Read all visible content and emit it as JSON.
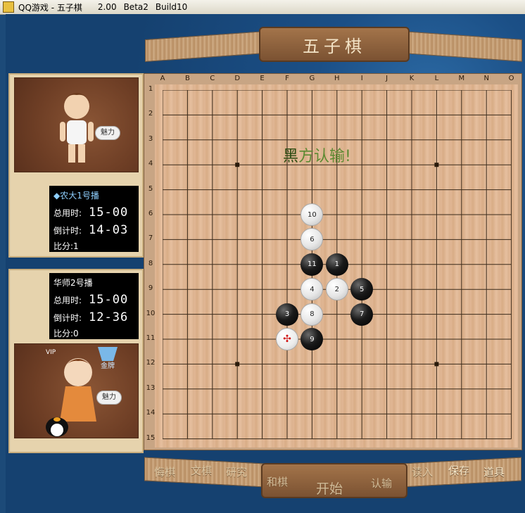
{
  "window": {
    "title": "QQ游戏 - 五子棋",
    "version": "2.00",
    "beta": "Beta2",
    "build": "Build10"
  },
  "banner": {
    "title": "五子棋"
  },
  "board": {
    "col_labels": [
      "A",
      "B",
      "C",
      "D",
      "E",
      "F",
      "G",
      "H",
      "I",
      "J",
      "K",
      "L",
      "M",
      "N",
      "O"
    ],
    "row_labels": [
      "1",
      "2",
      "3",
      "4",
      "5",
      "6",
      "7",
      "8",
      "9",
      "10",
      "11",
      "12",
      "13",
      "14",
      "15"
    ],
    "star_points": [
      [
        "D",
        4
      ],
      [
        "L",
        4
      ],
      [
        "D",
        12
      ],
      [
        "L",
        12
      ]
    ],
    "stones": [
      {
        "move": "1",
        "color": "black",
        "col": "H",
        "row": 8
      },
      {
        "move": "2",
        "color": "white",
        "col": "H",
        "row": 9
      },
      {
        "move": "3",
        "color": "black",
        "col": "F",
        "row": 10
      },
      {
        "move": "4",
        "color": "white",
        "col": "G",
        "row": 9
      },
      {
        "move": "5",
        "color": "black",
        "col": "I",
        "row": 9
      },
      {
        "move": "6",
        "color": "white",
        "col": "G",
        "row": 7
      },
      {
        "move": "7",
        "color": "black",
        "col": "I",
        "row": 10
      },
      {
        "move": "8",
        "color": "white",
        "col": "G",
        "row": 10
      },
      {
        "move": "9",
        "color": "black",
        "col": "G",
        "row": 11
      },
      {
        "move": "10",
        "color": "white",
        "col": "G",
        "row": 6
      },
      {
        "move": "11",
        "color": "black",
        "col": "G",
        "row": 8
      },
      {
        "move": "✣",
        "color": "last",
        "col": "F",
        "row": 11
      }
    ],
    "message_first": "黑",
    "message_rest": "方认输!"
  },
  "player1": {
    "name": "农大1号播",
    "charm": "魅力",
    "total_label": "总用时:",
    "total_time": "15-00",
    "countdown_label": "倒计时:",
    "countdown_time": "14-03",
    "score": "比分:1"
  },
  "player2": {
    "name": "华师2号播",
    "charm": "魅力",
    "badge": "金牌",
    "total_label": "总用时:",
    "total_time": "15-00",
    "countdown_label": "倒计时:",
    "countdown_time": "12-36",
    "score": "比分:0"
  },
  "controls": {
    "undo": "悔棋",
    "draw_request": "文棋",
    "study": "研究",
    "peace": "和棋",
    "start": "开始",
    "resign": "认输",
    "load": "读入",
    "save": "保存",
    "props": "道具"
  },
  "colors": {
    "background": "#1c4a78",
    "board": "#e2b896",
    "message": "#5d8a32",
    "panel": "#e6d3ad"
  }
}
